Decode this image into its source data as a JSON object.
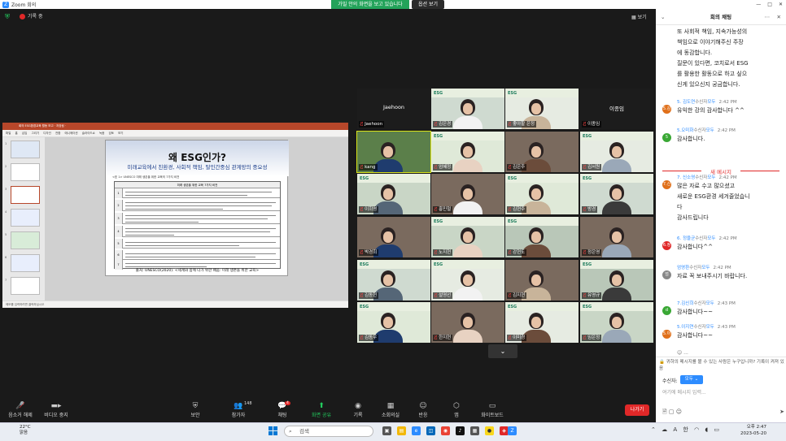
{
  "window": {
    "title": "Zoom 회의",
    "controls": [
      "—",
      "□",
      "✕"
    ]
  },
  "top": {
    "recording": "기록 중",
    "sharing_banner": "가밀 안의 화면을 보고 있습니다",
    "view_options": "옵션 보기",
    "view_button": "보기"
  },
  "ppt": {
    "title_bar": "회의 ESG환경교육 활동 보고 ‧ 저장됨 ‧ ",
    "ribbon": "파일 홈 삽입 그리기 디자인 전환 애니메이션 슬라이드쇼 녹음 검토 보기",
    "slide_title": "왜 ESG인가?",
    "slide_subtitle": "미래교육에서 친환경, 사회적 책임, 탈인간중심 관계망의 중요성",
    "table_caption": "<표 1> UNESCO 미래 생존을 위한 교육의 7가지 비전",
    "table_header": "미래 생존을 위한 교육 7가지 비전",
    "row_numbers": [
      "1",
      "2",
      "3",
      "4",
      "5",
      "6",
      "7"
    ],
    "source": "출처: UNESCO(2020). <세계와 함께 다가 위한 배움: 미래 생존을 위한 교육>",
    "status": "메모를 입력하려면 클릭하십시오",
    "thumb_numbers": [
      "1",
      "2",
      "3",
      "4",
      "5",
      "6",
      "7"
    ]
  },
  "gallery": [
    {
      "name": "Jaehoon",
      "type": "name"
    },
    {
      "name": "김은경",
      "type": "video"
    },
    {
      "name": "좋아할 은정",
      "type": "video"
    },
    {
      "name": "이종임",
      "type": "name"
    },
    {
      "name": "kang",
      "type": "video"
    },
    {
      "name": "엄혜정",
      "type": "video"
    },
    {
      "name": "김은주",
      "type": "video"
    },
    {
      "name": "김서원",
      "type": "video"
    },
    {
      "name": "이희영",
      "type": "video"
    },
    {
      "name": "홍민철",
      "type": "video"
    },
    {
      "name": "김현주",
      "type": "video"
    },
    {
      "name": "방경",
      "type": "video"
    },
    {
      "name": "박경희",
      "type": "video"
    },
    {
      "name": "노지현",
      "type": "video"
    },
    {
      "name": "강현도",
      "type": "video"
    },
    {
      "name": "정은영",
      "type": "video"
    },
    {
      "name": "김동현",
      "type": "video"
    },
    {
      "name": "설영선",
      "type": "video"
    },
    {
      "name": "김지현",
      "type": "video"
    },
    {
      "name": "유영규",
      "type": "video"
    },
    {
      "name": "김동우",
      "type": "video"
    },
    {
      "name": "한지현",
      "type": "video"
    },
    {
      "name": "이미경",
      "type": "video"
    },
    {
      "name": "임은정",
      "type": "video"
    }
  ],
  "toolbar": {
    "audio": "음소거 해제",
    "video": "비디오 중지",
    "security": "보안",
    "participants": "참가자",
    "participants_count": "148",
    "chat": "채팅",
    "chat_badge": "4",
    "share": "화면 공유",
    "record": "기록",
    "reactions": "소회의실",
    "apps": "반응",
    "apps2": "앱",
    "whiteboard": "화이트보드",
    "leave": "나가기"
  },
  "chat": {
    "title": "회의 채팅",
    "first_block": [
      "또 사회적 책임, 지속가능성의",
      "책임으로 이야기해주신 주장",
      "에 동감합니다.",
      "질문이 있다면, 코치로서 ESG",
      "를 활용한 활동으로 하고 싶으",
      "신게 있으신지 궁금합니다."
    ],
    "messages": [
      {
        "from": "5. 김도연",
        "to": "모두",
        "time": "2:42 PM",
        "text": [
          "유익한 강의 감사합니다 ^^"
        ],
        "avatar": "5.김",
        "color": "#e0701a"
      },
      {
        "from": "5.오미화",
        "to": "모두",
        "time": "2:42 PM",
        "text": [
          "감사합니다."
        ],
        "avatar": "5",
        "color": "#3aa835"
      }
    ],
    "new_message": "새 메시지",
    "new_messages": [
      {
        "from": "7. 신소영",
        "to": "모두",
        "time": "2:42 PM",
        "text": [
          "많은 자료 수고 많으셨고",
          "새로운 ESG환경 세겨줄었습니",
          "다",
          "감사드립니다"
        ],
        "avatar": "7.신",
        "color": "#e0701a"
      },
      {
        "from": "6. 정을균",
        "to": "모두",
        "time": "2:42 PM",
        "text": [
          "감사합니다^^"
        ],
        "avatar": "6.정",
        "color": "#e02828"
      },
      {
        "from": "엄영환",
        "to": "모두",
        "time": "2:42 PM",
        "text": [
          "자료 꼭 보내주시기 바랍니다."
        ],
        "avatar": "엄",
        "color": "#888"
      },
      {
        "from": "7.김신희",
        "to": "모두",
        "time": "2:43 PM",
        "text": [
          "감사합니다~~"
        ],
        "avatar": "d",
        "color": "#3aa835"
      },
      {
        "from": "5.이지연",
        "to": "모두",
        "time": "2:43 PM",
        "text": [
          "감사합니다~~"
        ],
        "avatar": "5.이",
        "color": "#e0701a"
      }
    ],
    "note": "귀하의 메시지를 볼 수 있는 사람은 누구입니까? 기록이 켜져 있음",
    "to_label": "수신자:",
    "to_value": "모두",
    "input_placeholder": "여기에 메시지 입력...",
    "to_word": "수신자",
    "ellipsis": "..."
  },
  "taskbar": {
    "temp": "22°C",
    "weather": "맑음",
    "search": "검색",
    "time": "오후 2:47",
    "date": "2023-05-20",
    "lang": "한"
  },
  "colors": {
    "accent": "#2d8cff",
    "record": "#e02828",
    "active_speaker": "#d9e21a"
  }
}
